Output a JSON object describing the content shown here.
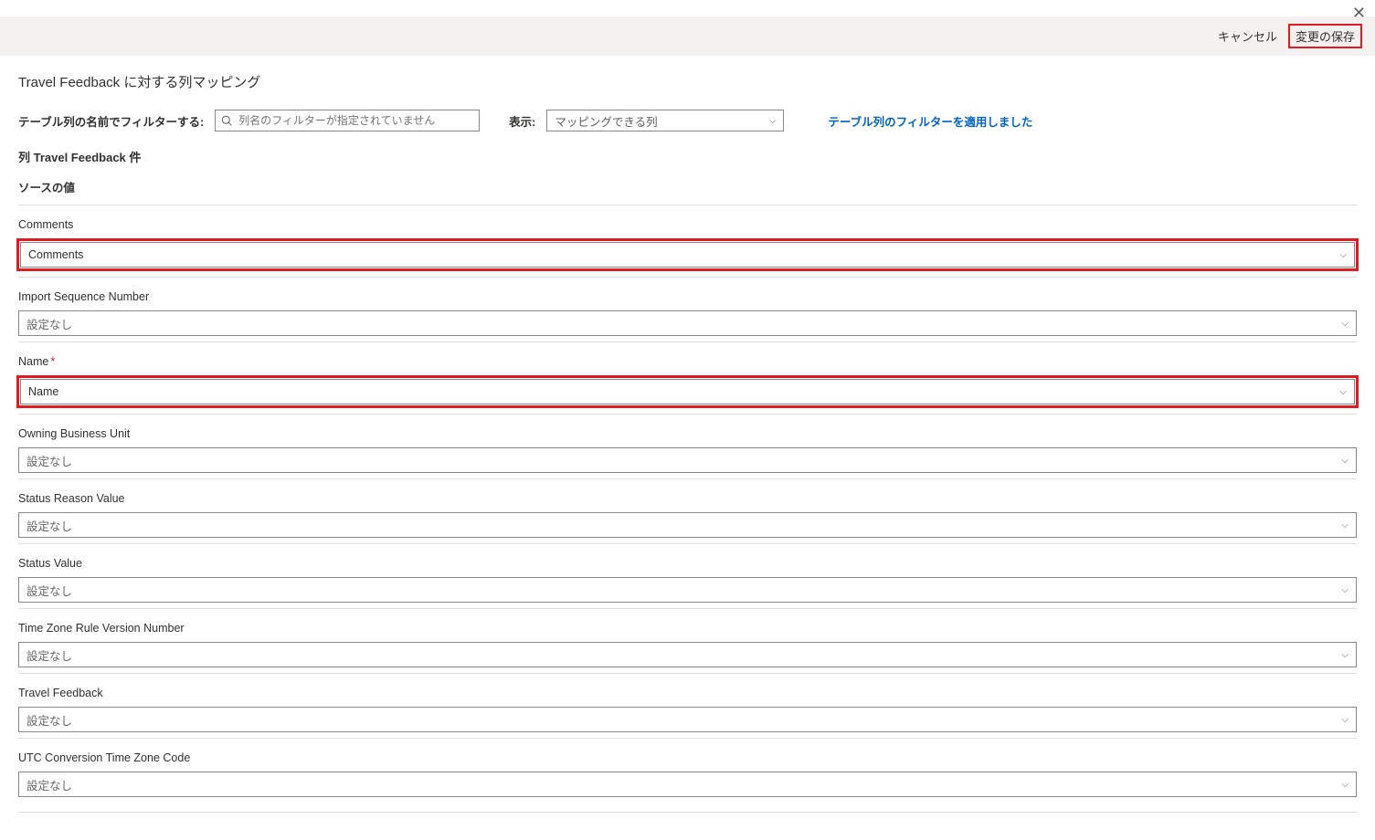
{
  "close": {
    "glyph": "✕"
  },
  "header": {
    "cancel": "キャンセル",
    "save": "変更の保存"
  },
  "title": "Travel Feedback に対する列マッピング",
  "filter": {
    "label": "テーブル列の名前でフィルターする:",
    "placeholder": "列名のフィルターが指定されていません",
    "display_label": "表示:",
    "display_value": "マッピングできる列",
    "applied_text": "テーブル列のフィルターを適用しました"
  },
  "section": {
    "head": "列 Travel Feedback 件",
    "sub": "ソースの値"
  },
  "fields": [
    {
      "label": "Comments",
      "value": "Comments",
      "required": false,
      "muted": false,
      "highlight": true
    },
    {
      "label": "Import Sequence Number",
      "value": "設定なし",
      "required": false,
      "muted": true,
      "highlight": false
    },
    {
      "label": "Name",
      "value": "Name",
      "required": true,
      "muted": false,
      "highlight": true
    },
    {
      "label": "Owning Business Unit",
      "value": "設定なし",
      "required": false,
      "muted": true,
      "highlight": false
    },
    {
      "label": "Status Reason Value",
      "value": "設定なし",
      "required": false,
      "muted": true,
      "highlight": false
    },
    {
      "label": "Status Value",
      "value": "設定なし",
      "required": false,
      "muted": true,
      "highlight": false
    },
    {
      "label": "Time Zone Rule Version Number",
      "value": "設定なし",
      "required": false,
      "muted": true,
      "highlight": false
    },
    {
      "label": "Travel Feedback",
      "value": "設定なし",
      "required": false,
      "muted": true,
      "highlight": false
    },
    {
      "label": "UTC Conversion Time Zone Code",
      "value": "設定なし",
      "required": false,
      "muted": true,
      "highlight": false
    }
  ]
}
